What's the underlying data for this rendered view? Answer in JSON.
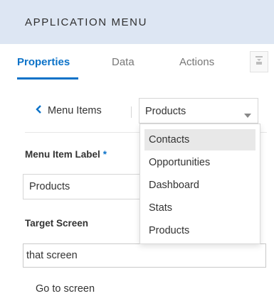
{
  "header": {
    "title": "APPLICATION MENU"
  },
  "tabs": [
    {
      "label": "Properties",
      "active": true
    },
    {
      "label": "Data",
      "active": false
    },
    {
      "label": "Actions",
      "active": false
    }
  ],
  "tabs_extra_icon": "collapse-panel-icon",
  "breadcrumb": {
    "back_label": "Menu Items"
  },
  "menu_select": {
    "value": "Products",
    "options": [
      "Contacts",
      "Opportunities",
      "Dashboard",
      "Stats",
      "Products"
    ],
    "highlighted": "Contacts"
  },
  "form": {
    "menu_item_label": {
      "label": "Menu Item Label",
      "required_mark": "*",
      "value": "Products"
    },
    "target_screen": {
      "label": "Target Screen",
      "value": "that screen"
    },
    "go_to_screen": "Go to screen"
  },
  "colors": {
    "accent": "#0b72c8",
    "header_bg": "#dde6f3",
    "option_highlight": "#e8e8e8"
  }
}
